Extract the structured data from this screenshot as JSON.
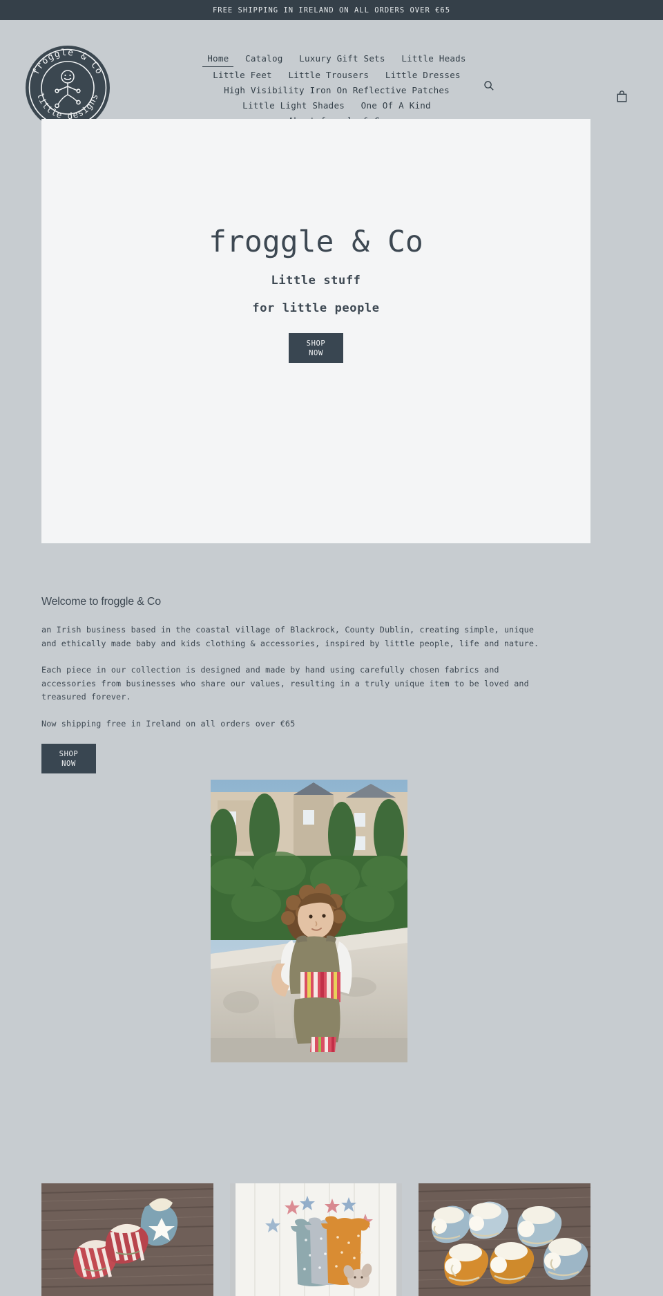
{
  "announcement": {
    "text": "FREE SHIPPING IN IRELAND ON ALL ORDERS OVER €65"
  },
  "header": {
    "logo": {
      "top_text": "froggle & Co",
      "bottom_text": "little designs",
      "icon": "stick-figure-badge-logo"
    },
    "nav_rows": [
      [
        {
          "label": "Home",
          "active": true
        },
        {
          "label": "Catalog",
          "active": false
        },
        {
          "label": "Luxury Gift Sets",
          "active": false
        },
        {
          "label": "Little Heads",
          "active": false
        }
      ],
      [
        {
          "label": "Little Feet",
          "active": false
        },
        {
          "label": "Little Trousers",
          "active": false
        },
        {
          "label": "Little Dresses",
          "active": false
        }
      ],
      [
        {
          "label": "High Visibility Iron On Reflective Patches",
          "active": false
        }
      ],
      [
        {
          "label": "Little Light Shades",
          "active": false
        },
        {
          "label": "One Of A Kind",
          "active": false
        }
      ],
      [
        {
          "label": "About froggle & Co",
          "active": false
        }
      ]
    ],
    "search_icon": "search-icon",
    "cart_icon": "shopping-bag-icon"
  },
  "hero": {
    "title": "froggle & Co",
    "subtitle_1": "Little stuff",
    "subtitle_2": "for little people",
    "cta_line_1": "SHOP",
    "cta_line_2": "NOW"
  },
  "welcome": {
    "heading": "Welcome to froggle & Co",
    "paragraph_1": "an Irish business based in the coastal village of Blackrock, County Dublin, creating simple, unique and ethically made baby and kids clothing & accessories, inspired by little people, life and nature.",
    "paragraph_2": "Each piece in our collection is designed and made by hand using carefully chosen fabrics and accessories from businesses who share our values, resulting in a truly unique item to be loved and treasured forever.",
    "paragraph_3": "Now shipping free in Ireland on all orders over €65",
    "cta_line_1": "SHOP",
    "cta_line_2": "NOW"
  },
  "feature_image": {
    "alt": "toddler-in-khaki-romper-with-striped-pockets-outdoors"
  },
  "product_tiles": [
    {
      "alt": "striped-baby-booties-and-blue-star-hat-on-wood"
    },
    {
      "alt": "three-star-print-baby-rompers-on-white-wood"
    },
    {
      "alt": "fur-lined-baby-booties-pairs-on-wood"
    }
  ],
  "colors": {
    "page_background": "#c7ccd0",
    "dark": "#354049",
    "hero_background": "#f4f5f6",
    "text": "#333f48"
  }
}
